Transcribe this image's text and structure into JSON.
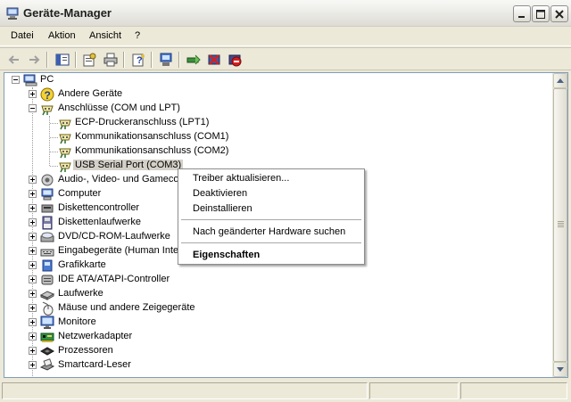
{
  "window": {
    "title": "Geräte-Manager",
    "icon": "device-manager-icon"
  },
  "menu": [
    "Datei",
    "Aktion",
    "Ansicht",
    "?"
  ],
  "toolbar": [
    "back-icon",
    "forward-icon",
    "console-tree-icon",
    "properties-icon",
    "print-icon",
    "help-icon",
    "scan-hardware-icon",
    "update-driver-icon",
    "uninstall-icon",
    "disable-icon"
  ],
  "tree": {
    "root": "PC",
    "nodes": [
      {
        "label": "Andere Geräte",
        "icon": "unknown-device-icon"
      },
      {
        "label": "Anschlüsse (COM und LPT)",
        "icon": "port-icon"
      },
      {
        "label": "ECP-Druckeranschluss (LPT1)",
        "icon": "port-icon"
      },
      {
        "label": "Kommunikationsanschluss (COM1)",
        "icon": "port-icon"
      },
      {
        "label": "Kommunikationsanschluss (COM2)",
        "icon": "port-icon"
      },
      {
        "label": "USB Serial Port (COM3)",
        "icon": "port-icon"
      },
      {
        "label": "Audio-, Video- und Gamecontroller",
        "icon": "audio-icon"
      },
      {
        "label": "Computer",
        "icon": "computer-icon"
      },
      {
        "label": "Diskettencontroller",
        "icon": "floppy-controller-icon"
      },
      {
        "label": "Diskettenlaufwerke",
        "icon": "floppy-drive-icon"
      },
      {
        "label": "DVD/CD-ROM-Laufwerke",
        "icon": "cdrom-icon"
      },
      {
        "label": "Eingabegeräte (Human Interface Devices)",
        "icon": "hid-icon"
      },
      {
        "label": "Grafikkarte",
        "icon": "display-adapter-icon"
      },
      {
        "label": "IDE ATA/ATAPI-Controller",
        "icon": "ide-controller-icon"
      },
      {
        "label": "Laufwerke",
        "icon": "disk-drive-icon"
      },
      {
        "label": "Mäuse und andere Zeigegeräte",
        "icon": "mouse-icon"
      },
      {
        "label": "Monitore",
        "icon": "monitor-icon"
      },
      {
        "label": "Netzwerkadapter",
        "icon": "network-adapter-icon"
      },
      {
        "label": "Prozessoren",
        "icon": "processor-icon"
      },
      {
        "label": "Smartcard-Leser",
        "icon": "smartcard-reader-icon"
      }
    ]
  },
  "context_menu": {
    "items": [
      "Treiber aktualisieren...",
      "Deaktivieren",
      "Deinstallieren",
      "Nach geänderter Hardware suchen",
      "Eigenschaften"
    ]
  },
  "colors": {
    "selection_bg": "#d4d0c8",
    "panel_border": "#7f9db9",
    "window_bg": "#ece9d8"
  }
}
